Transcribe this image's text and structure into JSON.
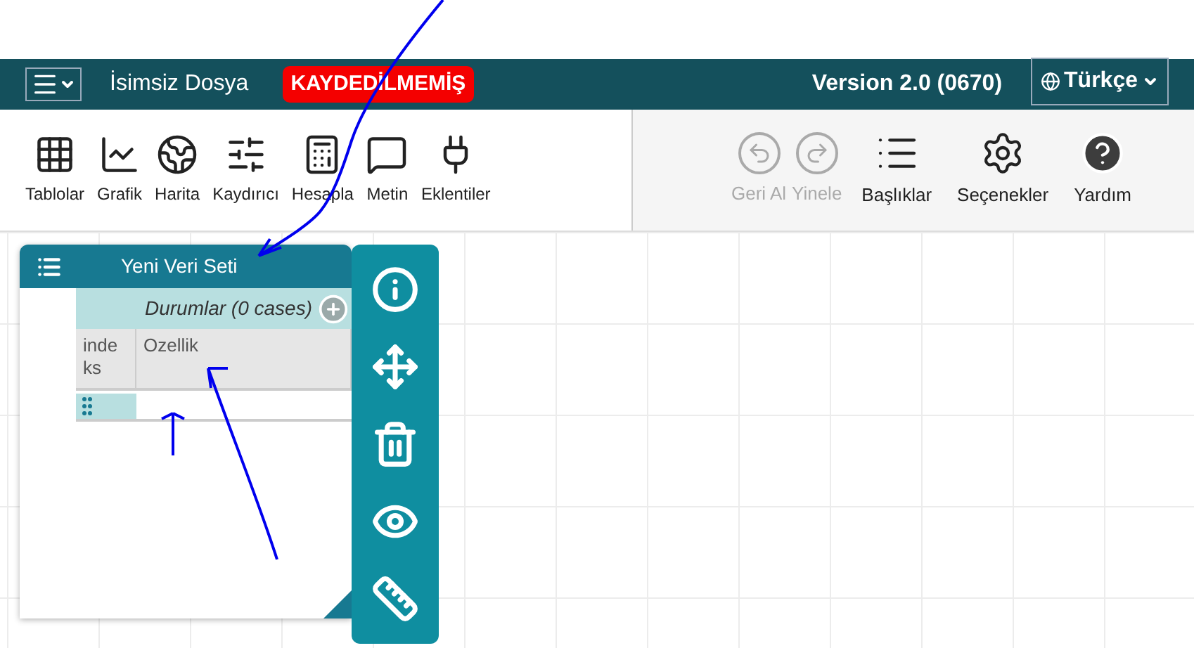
{
  "header": {
    "file_name": "İsimsiz Dosya",
    "status_badge": "KAYDEDİLMEMİŞ",
    "version": "Version 2.0 (0670)",
    "language": "Türkçe"
  },
  "toolbar": {
    "tools": [
      {
        "label": "Tablolar",
        "kind": "table"
      },
      {
        "label": "Grafik",
        "kind": "graph"
      },
      {
        "label": "Harita",
        "kind": "map"
      },
      {
        "label": "Kaydırıcı",
        "kind": "slider"
      },
      {
        "label": "Hesapla",
        "kind": "calculator"
      },
      {
        "label": "Metin",
        "kind": "text"
      },
      {
        "label": "Eklentiler",
        "kind": "plugins"
      }
    ],
    "actions": [
      {
        "label": "Geri Al",
        "kind": "undo",
        "disabled": true
      },
      {
        "label": "Yinele",
        "kind": "redo",
        "disabled": true
      },
      {
        "label": "Başlıklar",
        "kind": "headings",
        "disabled": false
      },
      {
        "label": "Seçenekler",
        "kind": "options",
        "disabled": false
      },
      {
        "label": "Yardım",
        "kind": "help",
        "disabled": false
      }
    ]
  },
  "table_window": {
    "title": "Yeni Veri Seti",
    "collection": "Durumlar (0 cases)",
    "columns": [
      "indeks",
      "Ozellik"
    ]
  },
  "inspector": {
    "buttons": [
      {
        "kind": "info"
      },
      {
        "kind": "scale"
      },
      {
        "kind": "delete"
      },
      {
        "kind": "hide"
      },
      {
        "kind": "ruler"
      }
    ]
  }
}
